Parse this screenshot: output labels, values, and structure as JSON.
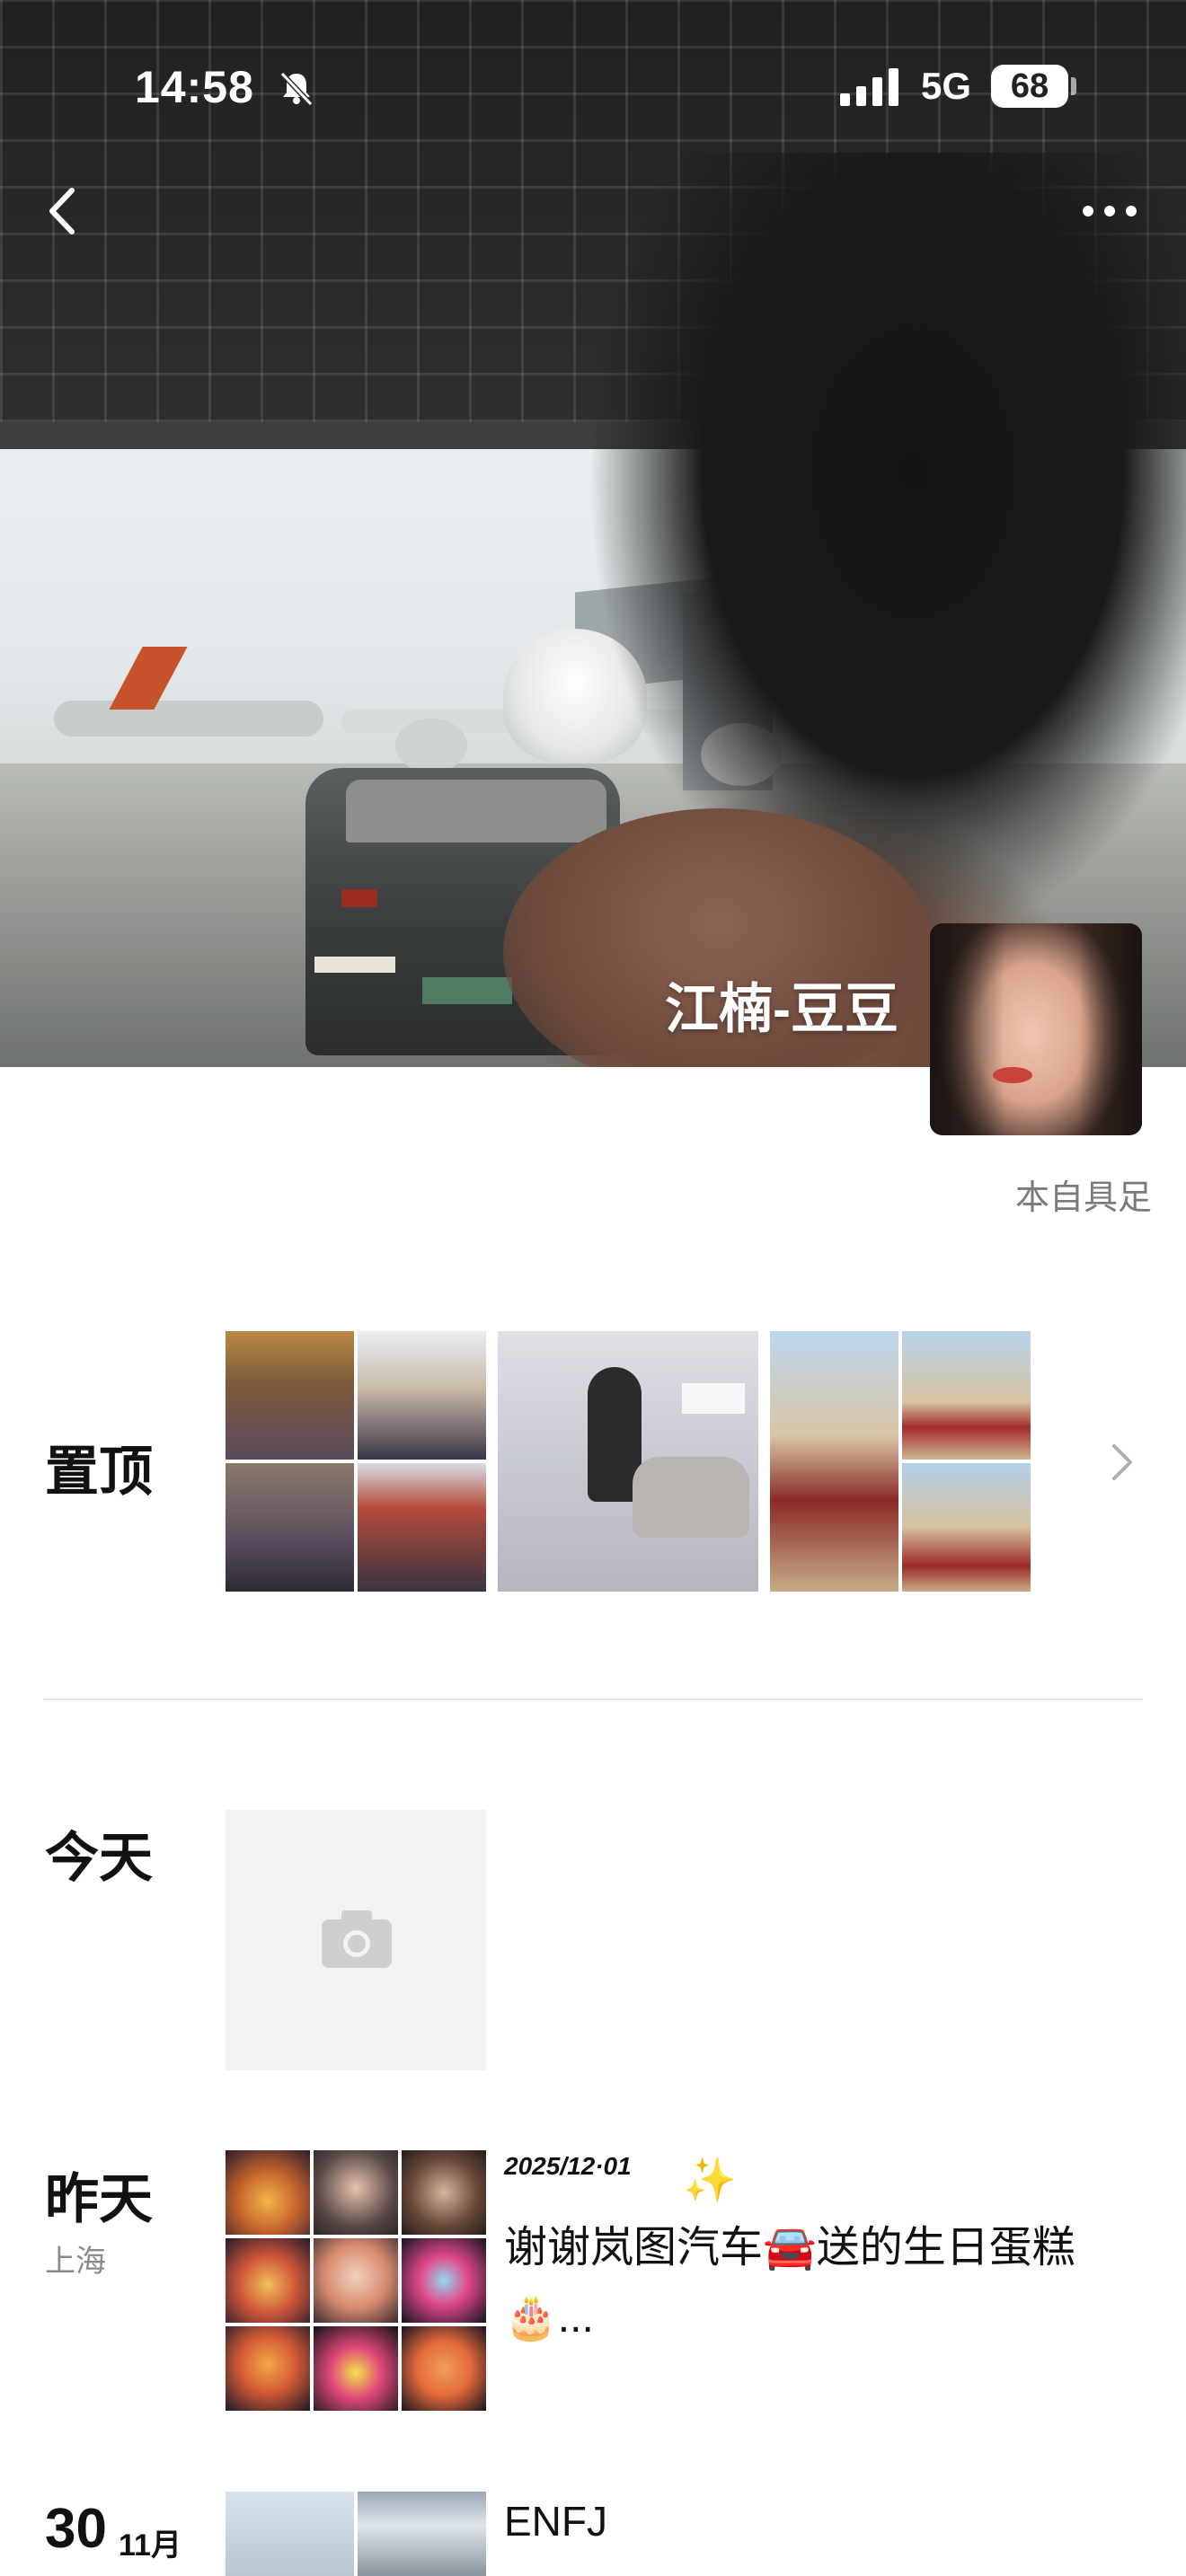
{
  "status_bar": {
    "time": "14:58",
    "network": "5G",
    "battery": "68"
  },
  "profile": {
    "name": "江楠-豆豆",
    "signature": "本自具足"
  },
  "pinned": {
    "label": "置顶",
    "thumbnails": [
      {
        "description": "temple-collage"
      },
      {
        "description": "woman-with-silver-car"
      },
      {
        "description": "desert-red-dress-collage"
      }
    ]
  },
  "feed": [
    {
      "day_label": "今天",
      "location": "",
      "type": "camera-placeholder"
    },
    {
      "day_label": "昨天",
      "location": "上海",
      "date_stamp": "2025/12·01",
      "sparkle": "✨",
      "text": "谢谢岚图汽车🚘送的生日蛋糕🎂..."
    },
    {
      "day_number": "30",
      "month": "11月",
      "text": "ENFJ"
    }
  ],
  "colors": {
    "accent": "#111111",
    "muted": "#7a7a7a",
    "divider": "#e6e6e6",
    "placeholder": "#f2f2f2"
  }
}
